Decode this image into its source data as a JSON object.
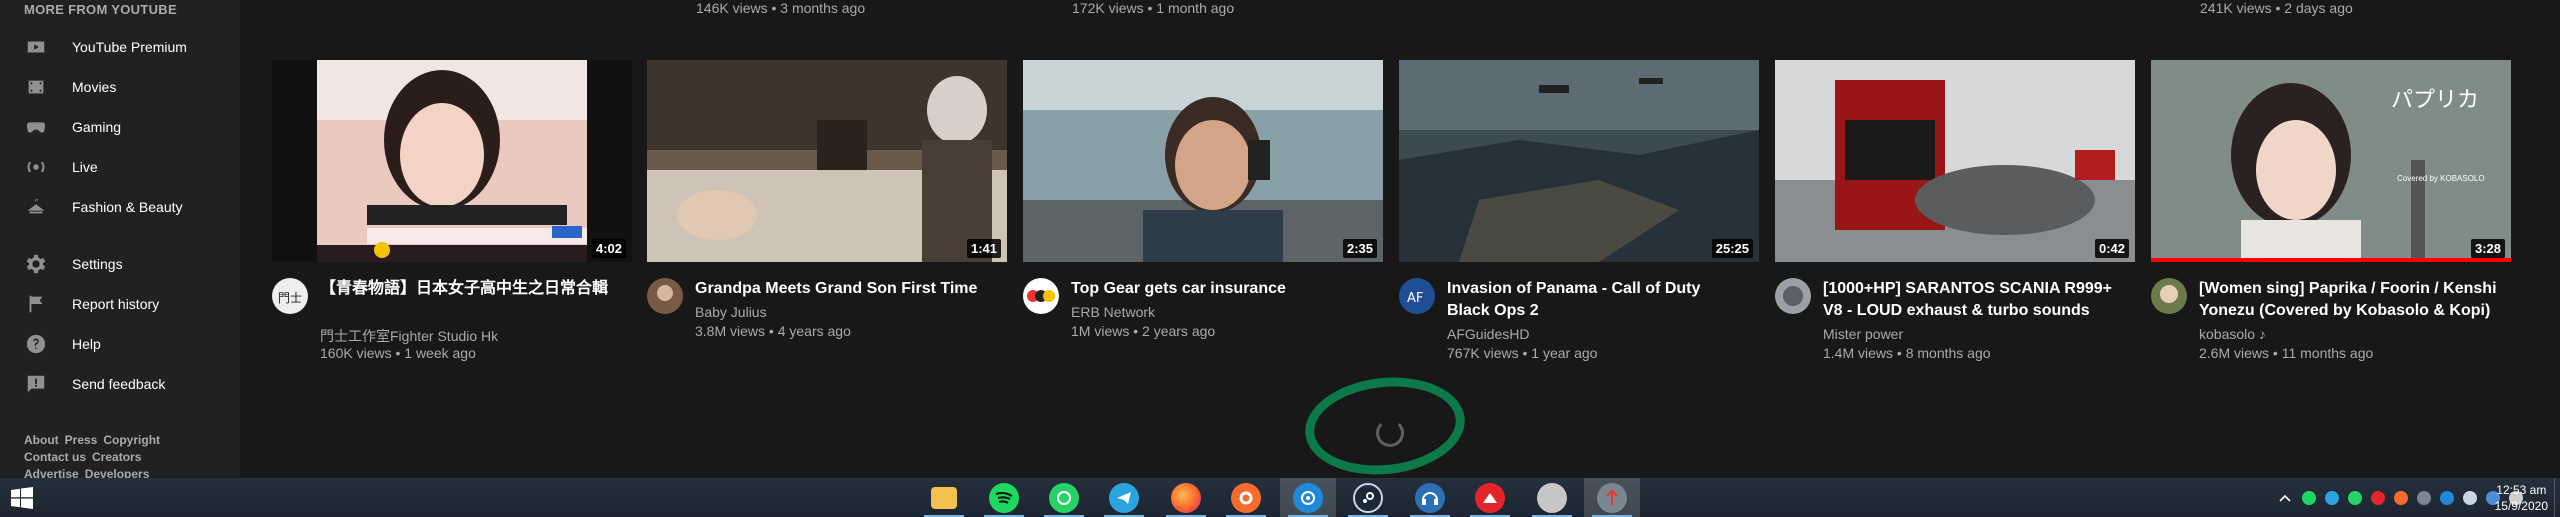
{
  "sidebar": {
    "heading": "MORE FROM YOUTUBE",
    "items": [
      {
        "label": "YouTube Premium",
        "icon": "youtube-premium-icon"
      },
      {
        "label": "Movies",
        "icon": "movies-icon"
      },
      {
        "label": "Gaming",
        "icon": "gaming-icon"
      },
      {
        "label": "Live",
        "icon": "live-icon"
      },
      {
        "label": "Fashion & Beauty",
        "icon": "fashion-icon"
      },
      {
        "label": "Settings",
        "icon": "gear-icon"
      },
      {
        "label": "Report history",
        "icon": "flag-icon"
      },
      {
        "label": "Help",
        "icon": "help-icon"
      },
      {
        "label": "Send feedback",
        "icon": "feedback-icon"
      }
    ],
    "footer": {
      "about": "About",
      "press": "Press",
      "copyright": "Copyright",
      "contact": "Contact us",
      "creators": "Creators",
      "advertise": "Advertise",
      "developers": "Developers"
    }
  },
  "previous_row": [
    "146K views • 3 months ago",
    "172K views • 1 month ago",
    "241K views • 2 days ago"
  ],
  "videos": [
    {
      "title": "【青春物語】日本女子高中生之日常合輯",
      "channel": "門士工作室Fighter Studio Hk",
      "views": "160K views • 1 week ago",
      "duration": "4:02"
    },
    {
      "title": "Grandpa Meets Grand Son First Time",
      "channel": "Baby Julius",
      "views": "3.8M views • 4 years ago",
      "duration": "1:41"
    },
    {
      "title": "Top Gear gets car insurance",
      "channel": "ERB Network",
      "views": "1M views • 2 years ago",
      "duration": "2:35"
    },
    {
      "title": "Invasion of Panama - Call of Duty Black Ops 2",
      "channel": "AFGuidesHD",
      "views": "767K views • 1 year ago",
      "duration": "25:25"
    },
    {
      "title": "[1000+HP] SARANTOS SCANIA R999+ V8 - LOUD exhaust & turbo sounds",
      "channel": "Mister power",
      "views": "1.4M views • 8 months ago",
      "duration": "0:42"
    },
    {
      "title": "[Women sing] Paprika / Foorin / Kenshi Yonezu (Covered by Kobasolo & Kopi)",
      "channel": "kobasolo ♪",
      "views": "2.6M views • 11 months ago",
      "duration": "3:28"
    }
  ],
  "thumb_text": {
    "v6_title": "パプリカ",
    "v6_sub": "Covered by KOBASOLO"
  },
  "taskbar": {
    "apps": [
      "file-explorer-icon",
      "spotify-icon",
      "whatsapp-icon",
      "telegram-icon",
      "firefox-icon",
      "origin-icon",
      "uplay-icon",
      "steam-icon",
      "headset-icon",
      "game-app-icon",
      "app-icon",
      "app-active-icon"
    ],
    "time": "12:53 am",
    "date": "15/9/2020"
  },
  "colors": {
    "accent_red": "#ff0000",
    "ring_green": "#0b7a48",
    "sidebar_bg": "#212121",
    "page_bg": "#181818"
  }
}
